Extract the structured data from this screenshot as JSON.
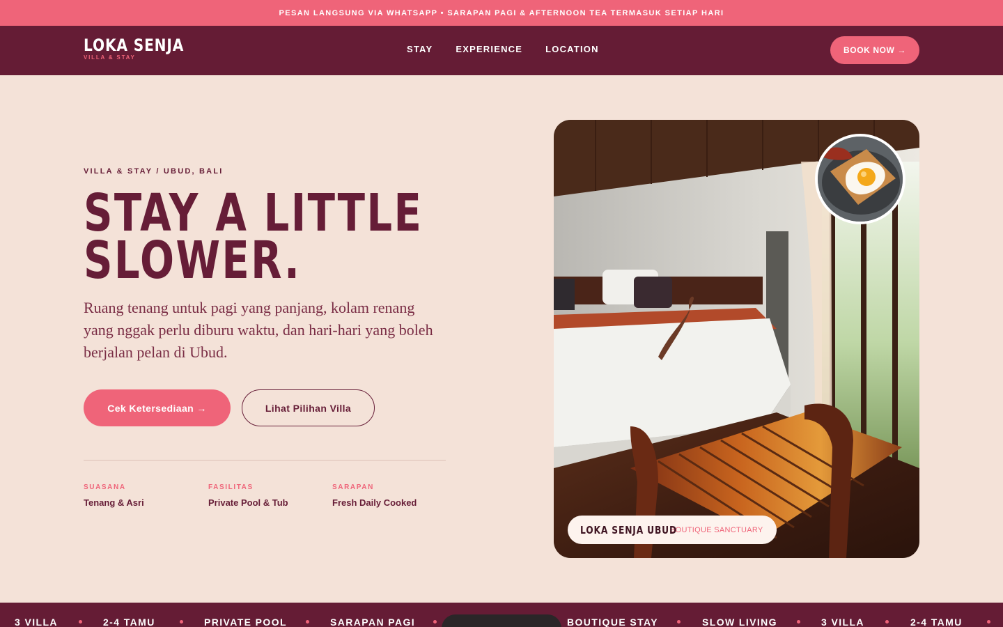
{
  "announcement": "PESAN LANGSUNG VIA WHATSAPP • SARAPAN PAGI & AFTERNOON TEA TERMASUK SETIAP HARI",
  "brand": {
    "name": "LOKA SENJA",
    "tagline": "VILLA & STAY"
  },
  "nav": {
    "items": [
      "STAY",
      "EXPERIENCE",
      "LOCATION"
    ],
    "cta": "BOOK NOW →"
  },
  "hero": {
    "eyebrow": "VILLA & STAY / UBUD, BALI",
    "headline_line1": "STAY A LITTLE",
    "headline_line2": "SLOWER.",
    "lede": "Ruang tenang untuk pagi yang panjang, kolam renang yang nggak perlu diburu waktu, dan hari-hari yang boleh berjalan pelan di Ubud.",
    "primary_cta": "Cek Ketersediaan →",
    "secondary_cta": "Lihat Pilihan Villa"
  },
  "features": [
    {
      "label": "SUASANA",
      "value": "Tenang & Asri"
    },
    {
      "label": "FASILITAS",
      "value": "Private Pool & Tub"
    },
    {
      "label": "SARAPAN",
      "value": "Fresh Daily Cooked"
    }
  ],
  "photo_caption": {
    "title": "LOKA SENJA UBUD",
    "subtitle": "BOUTIQUE SANCTUARY"
  },
  "ticker": [
    "3 VILLA",
    "2-4 TAMU",
    "PRIVATE POOL",
    "SARAPAN PAGI",
    "BOUTIQUE STAY",
    "SLOW LIVING",
    "3 VILLA",
    "2-4 TAMU"
  ],
  "colors": {
    "accent": "#ef6479",
    "primary": "#651c35",
    "background": "#f4e2d8"
  }
}
